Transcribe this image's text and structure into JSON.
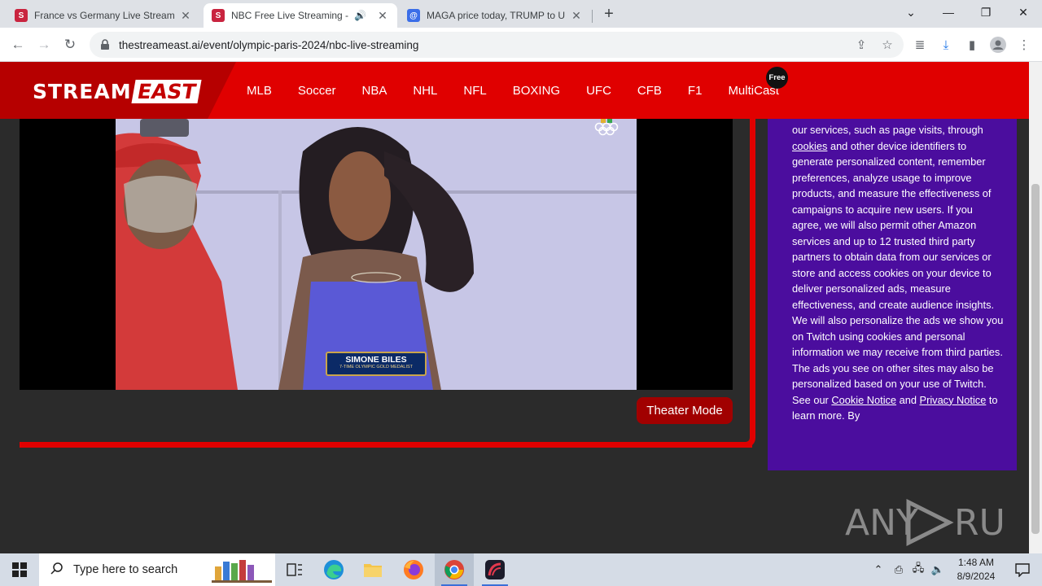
{
  "browser": {
    "tabs": [
      {
        "title": "France vs Germany Live Streamin",
        "favicon": "S"
      },
      {
        "title": "NBC Free Live Streaming - S",
        "favicon": "S"
      },
      {
        "title": "MAGA price today, TRUMP to US",
        "favicon": "@"
      }
    ],
    "url": "thestreameast.ai/event/olympic-paris-2024/nbc-live-streaming"
  },
  "site": {
    "logo_part1": "STREAM",
    "logo_part2": "EAST",
    "nav": [
      "MLB",
      "Soccer",
      "NBA",
      "NHL",
      "NFL",
      "BOXING",
      "UFC",
      "CFB",
      "F1",
      "MultiCast"
    ],
    "free_badge": "Free"
  },
  "player": {
    "lower_third_name": "SIMONE BILES",
    "lower_third_sub": "7-TIME OLYMPIC GOLD MEDALIST",
    "theater_label": "Theater Mode"
  },
  "cookie": {
    "p1": "our services, such as page visits, through ",
    "link_cookies": "cookies",
    "p2": " and other device identifiers to generate personalized content, remember preferences, analyze usage to improve products, and measure the effectiveness of campaigns to acquire new users. If you agree, we will also permit other Amazon services and up to 12 trusted third party partners to obtain data from our services or store and access cookies on your device to deliver personalized ads, measure effectiveness, and create audience insights. We will also personalize the ads we show you on Twitch using cookies and personal information we may receive from third parties. The ads you see on other sites may also be personalized based on your use of Twitch. See our ",
    "link_cookie_notice": "Cookie Notice",
    "p3": " and ",
    "link_privacy": "Privacy Notice",
    "p4": " to learn more. By"
  },
  "watermark": "ANY RUN",
  "taskbar": {
    "search_placeholder": "Type here to search",
    "time": "1:48 AM",
    "date": "8/9/2024"
  },
  "colors": {
    "header_red": "#e00000",
    "cookie_purple": "#4b0d9e",
    "theater_btn": "#a10000"
  }
}
